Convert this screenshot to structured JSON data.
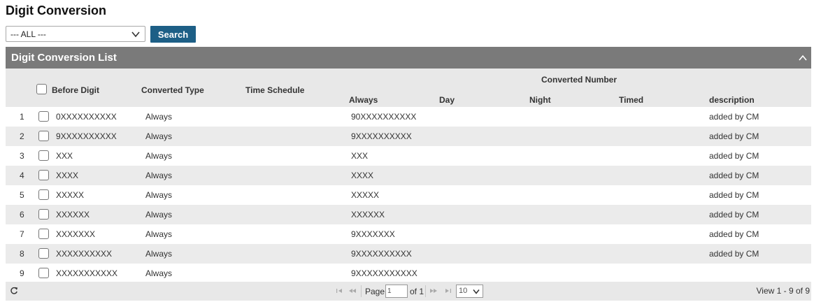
{
  "page": {
    "title": "Digit Conversion"
  },
  "filter": {
    "selected": "--- ALL ---",
    "search_label": "Search"
  },
  "panel": {
    "title": "Digit Conversion List"
  },
  "columns": {
    "before_digit": "Before Digit",
    "converted_type": "Converted Type",
    "time_schedule": "Time Schedule",
    "converted_number": "Converted Number",
    "always": "Always",
    "day": "Day",
    "night": "Night",
    "timed": "Timed",
    "description": "description"
  },
  "rows": [
    {
      "num": "1",
      "before": "0XXXXXXXXXX",
      "type": "Always",
      "schedule": "",
      "always": "90XXXXXXXXXX",
      "day": "",
      "night": "",
      "timed": "",
      "description": "added by CM"
    },
    {
      "num": "2",
      "before": "9XXXXXXXXXX",
      "type": "Always",
      "schedule": "",
      "always": "9XXXXXXXXXX",
      "day": "",
      "night": "",
      "timed": "",
      "description": "added by CM"
    },
    {
      "num": "3",
      "before": "XXX",
      "type": "Always",
      "schedule": "",
      "always": "XXX",
      "day": "",
      "night": "",
      "timed": "",
      "description": "added by CM"
    },
    {
      "num": "4",
      "before": "XXXX",
      "type": "Always",
      "schedule": "",
      "always": "XXXX",
      "day": "",
      "night": "",
      "timed": "",
      "description": "added by CM"
    },
    {
      "num": "5",
      "before": "XXXXX",
      "type": "Always",
      "schedule": "",
      "always": "XXXXX",
      "day": "",
      "night": "",
      "timed": "",
      "description": "added by CM"
    },
    {
      "num": "6",
      "before": "XXXXXX",
      "type": "Always",
      "schedule": "",
      "always": "XXXXXX",
      "day": "",
      "night": "",
      "timed": "",
      "description": "added by CM"
    },
    {
      "num": "7",
      "before": "XXXXXXX",
      "type": "Always",
      "schedule": "",
      "always": "9XXXXXXX",
      "day": "",
      "night": "",
      "timed": "",
      "description": "added by CM"
    },
    {
      "num": "8",
      "before": "XXXXXXXXXX",
      "type": "Always",
      "schedule": "",
      "always": "9XXXXXXXXXX",
      "day": "",
      "night": "",
      "timed": "",
      "description": "added by CM"
    },
    {
      "num": "9",
      "before": "XXXXXXXXXXX",
      "type": "Always",
      "schedule": "",
      "always": "9XXXXXXXXXXX",
      "day": "",
      "night": "",
      "timed": "",
      "description": ""
    }
  ],
  "pager": {
    "page_label": "Page",
    "page_value": "1",
    "of_label": "of 1",
    "page_size": "10",
    "view_text": "View 1 - 9 of 9"
  },
  "icons": {
    "refresh": "refresh-icon",
    "first": "first-page-icon",
    "prev": "prev-page-icon",
    "next": "next-page-icon",
    "last": "last-page-icon",
    "collapse": "chevron-up-icon",
    "dropdown": "chevron-down-icon"
  },
  "colors": {
    "accent": "#1d5f86",
    "panel_header": "#7a7a7a",
    "grid_header": "#e8e8e8",
    "row_alt": "#ebebeb"
  }
}
